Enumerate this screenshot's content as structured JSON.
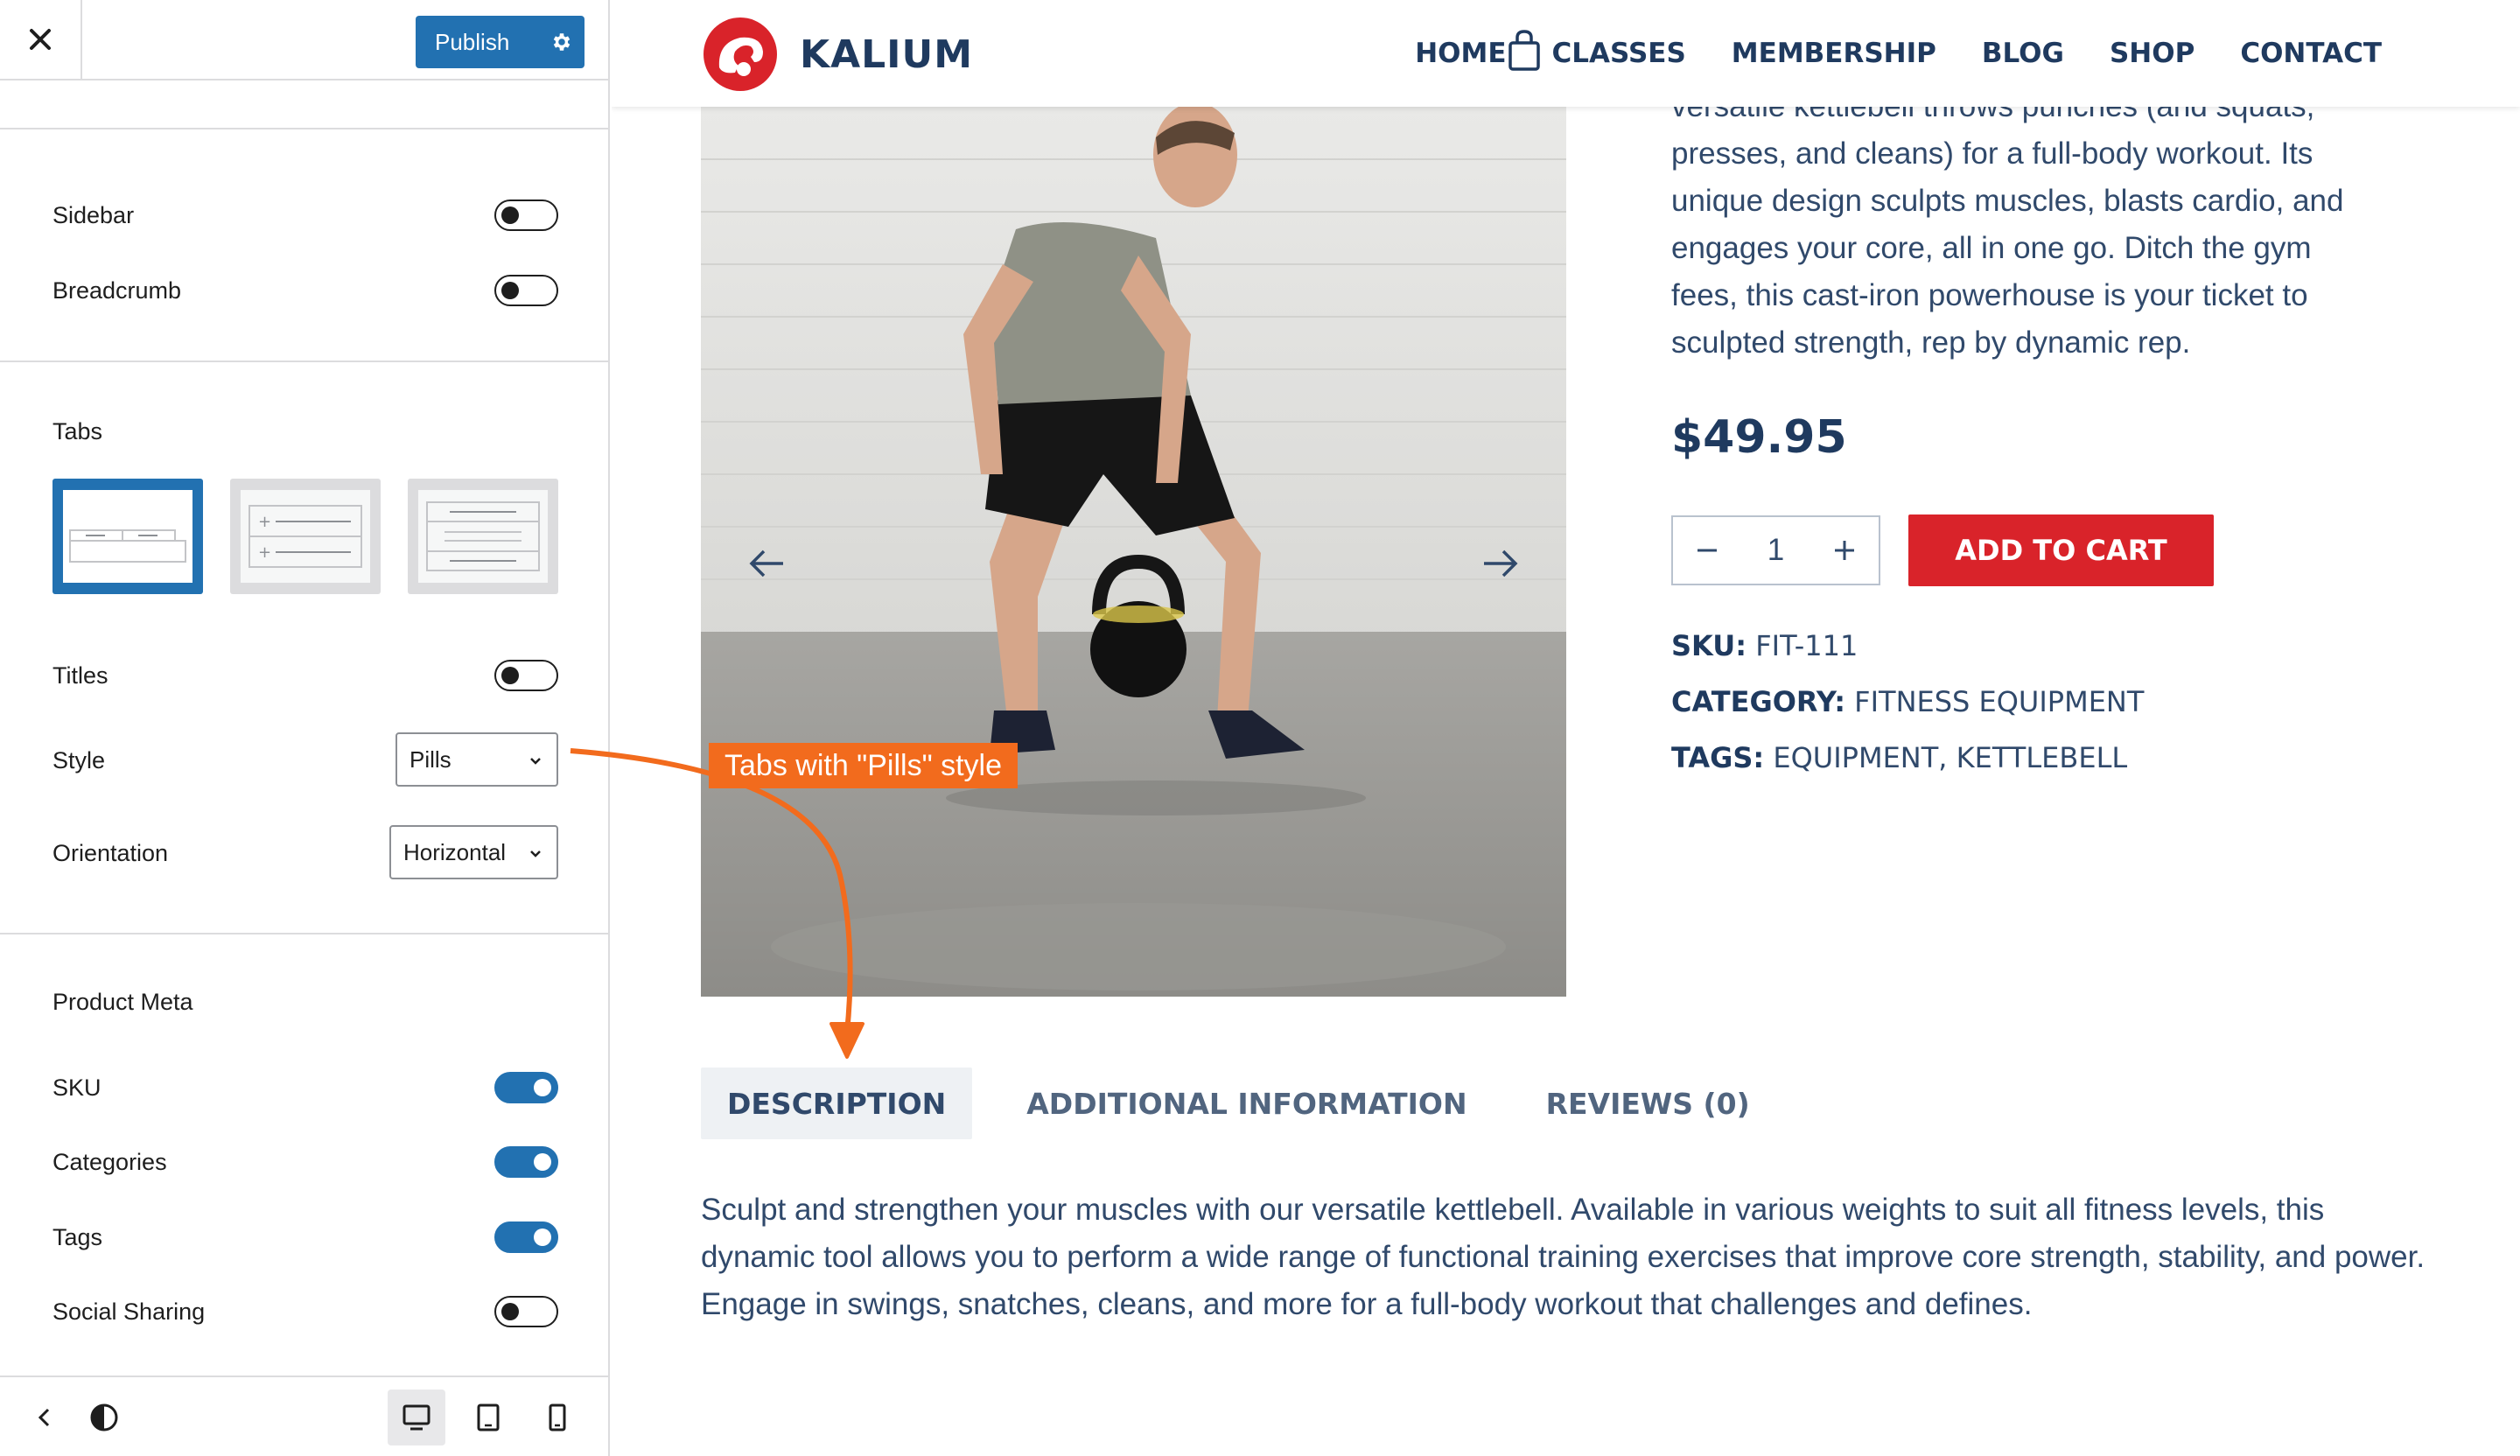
{
  "customizer": {
    "publish_label": "Publish",
    "sections": {
      "display": [
        {
          "label": "Sidebar",
          "on": false
        },
        {
          "label": "Breadcrumb",
          "on": false
        }
      ],
      "tabs_heading": "Tabs",
      "tabs_settings": {
        "titles": {
          "label": "Titles",
          "on": false
        },
        "style": {
          "label": "Style",
          "value": "Pills"
        },
        "orientation": {
          "label": "Orientation",
          "value": "Horizontal"
        }
      },
      "product_meta_heading": "Product Meta",
      "product_meta": [
        {
          "label": "SKU",
          "on": true
        },
        {
          "label": "Categories",
          "on": true
        },
        {
          "label": "Tags",
          "on": true
        },
        {
          "label": "Social Sharing",
          "on": false
        }
      ]
    },
    "accent_color": "#2271b1"
  },
  "site": {
    "logo_text": "KALIUM",
    "nav": [
      "HOME",
      "CLASSES",
      "MEMBERSHIP",
      "BLOG",
      "SHOP",
      "CONTACT"
    ],
    "short_description_lines": [
      "versatile kettlebell throws punches (and squats,",
      "presses, and cleans) for a full-body workout. Its",
      "unique design sculpts muscles, blasts cardio, and",
      "engages your core, all in one go. Ditch the gym",
      "fees, this cast-iron powerhouse is your ticket to",
      "sculpted strength, rep by dynamic rep."
    ],
    "price": "$49.95",
    "quantity": "1",
    "add_to_cart": "ADD TO CART",
    "meta": {
      "sku_label": "SKU:",
      "sku_value": "FIT-111",
      "category_label": "CATEGORY:",
      "category_value": "FITNESS EQUIPMENT",
      "tags_label": "TAGS:",
      "tags_value_1": "EQUIPMENT",
      "tags_sep": ", ",
      "tags_value_2": "KETTLEBELL"
    },
    "tabs": [
      "DESCRIPTION",
      "ADDITIONAL INFORMATION",
      "REVIEWS (0)"
    ],
    "description": "Sculpt and strengthen your muscles with our versatile kettlebell. Available in various weights to suit all fitness levels, this dynamic tool allows you to perform a wide range of functional training exercises that improve core strength, stability, and power. Engage in swings, snatches, cleans, and more for a full-body workout that challenges and defines.",
    "brand_color": "#d9232a"
  },
  "annotation": {
    "text": "Tabs with \"Pills\" style",
    "color": "#f26b1d"
  }
}
